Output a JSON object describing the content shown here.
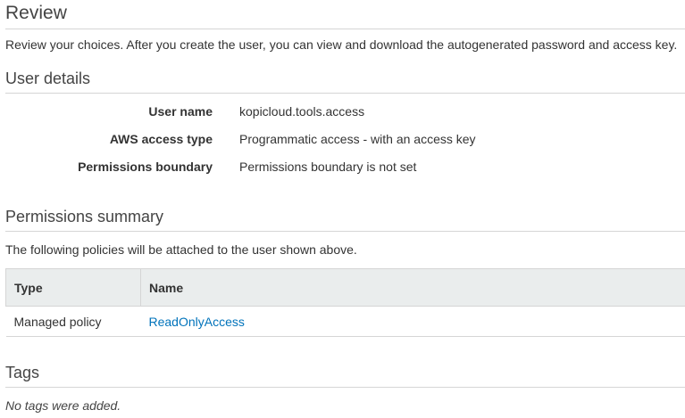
{
  "page": {
    "title": "Review",
    "intro": "Review your choices. After you create the user, you can view and download the autogenerated password and access key."
  },
  "user_details": {
    "heading": "User details",
    "rows": [
      {
        "label": "User name",
        "value": "kopicloud.tools.access"
      },
      {
        "label": "AWS access type",
        "value": "Programmatic access - with an access key"
      },
      {
        "label": "Permissions boundary",
        "value": "Permissions boundary is not set"
      }
    ]
  },
  "permissions_summary": {
    "heading": "Permissions summary",
    "note": "The following policies will be attached to the user shown above.",
    "columns": [
      "Type",
      "Name"
    ],
    "rows": [
      {
        "type": "Managed policy",
        "name": "ReadOnlyAccess"
      }
    ],
    "link_color": "#0073bb"
  },
  "tags": {
    "heading": "Tags",
    "empty_message": "No tags were added."
  }
}
